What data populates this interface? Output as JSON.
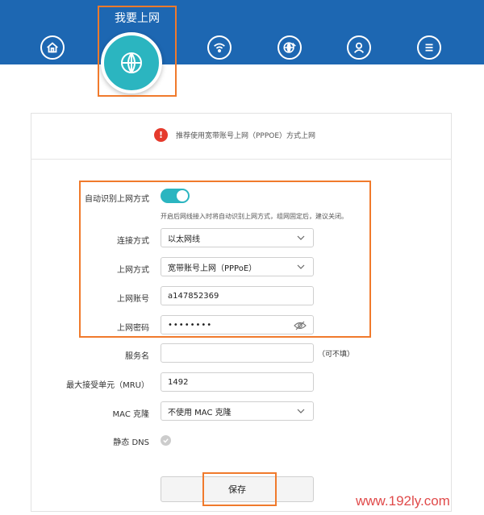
{
  "nav": {
    "active_label": "我要上网",
    "icons": [
      "home-icon",
      "globe-icon",
      "wifi-icon",
      "globe-settings-icon",
      "user-icon",
      "menu-icon"
    ]
  },
  "notice": {
    "text": "推荐使用宽带账号上网（PPPOE）方式上网"
  },
  "form": {
    "auto_detect_label": "自动识别上网方式",
    "auto_detect_on": true,
    "auto_detect_hint": "开启后网线接入时将自动识别上网方式，组网固定后，建议关闭。",
    "connection_label": "连接方式",
    "connection_value": "以太网线",
    "mode_label": "上网方式",
    "mode_value": "宽带账号上网（PPPoE）",
    "account_label": "上网账号",
    "account_value": "a147852369",
    "password_label": "上网密码",
    "password_value": "••••••••",
    "service_label": "服务名",
    "service_value": "",
    "service_optional": "（可不填）",
    "mru_label": "最大接受单元（MRU）",
    "mru_value": "1492",
    "mac_label": "MAC 克隆",
    "mac_value": "不使用 MAC 克隆",
    "dns_label": "静态 DNS",
    "save_label": "保存"
  },
  "watermark": "www.192ly.com",
  "colors": {
    "nav_bg": "#1d67b2",
    "accent": "#2bb5c0",
    "highlight": "#f07a2c",
    "warning": "#e53a2c"
  }
}
